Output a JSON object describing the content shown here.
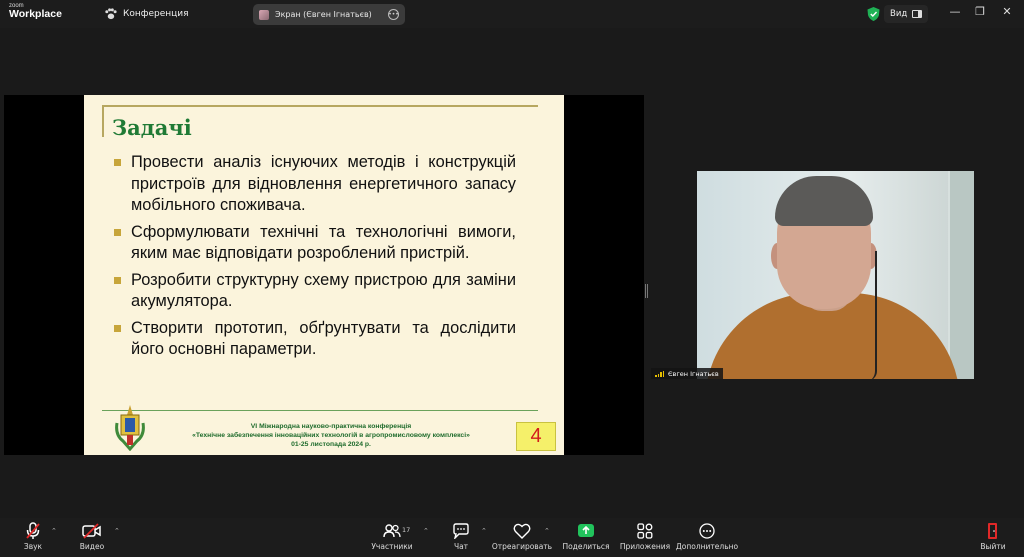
{
  "titlebar": {
    "logo_top": "zoom",
    "logo_bottom": "Workplace",
    "meeting_title": "Конференция",
    "screen_tab": "Экран (Євген Ігнатьєв)",
    "view_label": "Вид"
  },
  "slide": {
    "title": "Задачі",
    "bullets": [
      "Провести аналіз існуючих методів і конструкцій пристроїв для відновлення енергетичного запасу мобільного споживача.",
      "Сформулювати технічні та технологічні вимоги, яким має відповідати розроблений пристрій.",
      "Розробити структурну схему пристрою для заміни акумулятора.",
      "Створити прототип, обґрунтувати та дослідити його основні параметри."
    ],
    "footer_line1": "VI Міжнародна науково-практична конференція",
    "footer_line2": "«Технічне забезпечення інноваційних технологій в агропромисловому комплексі»",
    "footer_line3": "01-25 листопада 2024 р.",
    "page_number": "4"
  },
  "participant": {
    "name": "Євген Ігнатьєв"
  },
  "toolbar": {
    "audio_label": "Звук",
    "video_label": "Видео",
    "participants_label": "Участники",
    "participants_count": "17",
    "chat_label": "Чат",
    "react_label": "Отреагировать",
    "share_label": "Поделиться",
    "apps_label": "Приложения",
    "more_label": "Дополнительно",
    "leave_label": "Выйти"
  },
  "colors": {
    "share_accent": "#21c35c",
    "slide_title": "#1f7a35",
    "page_number": "#d21c1c",
    "leave_icon": "#e02828"
  }
}
